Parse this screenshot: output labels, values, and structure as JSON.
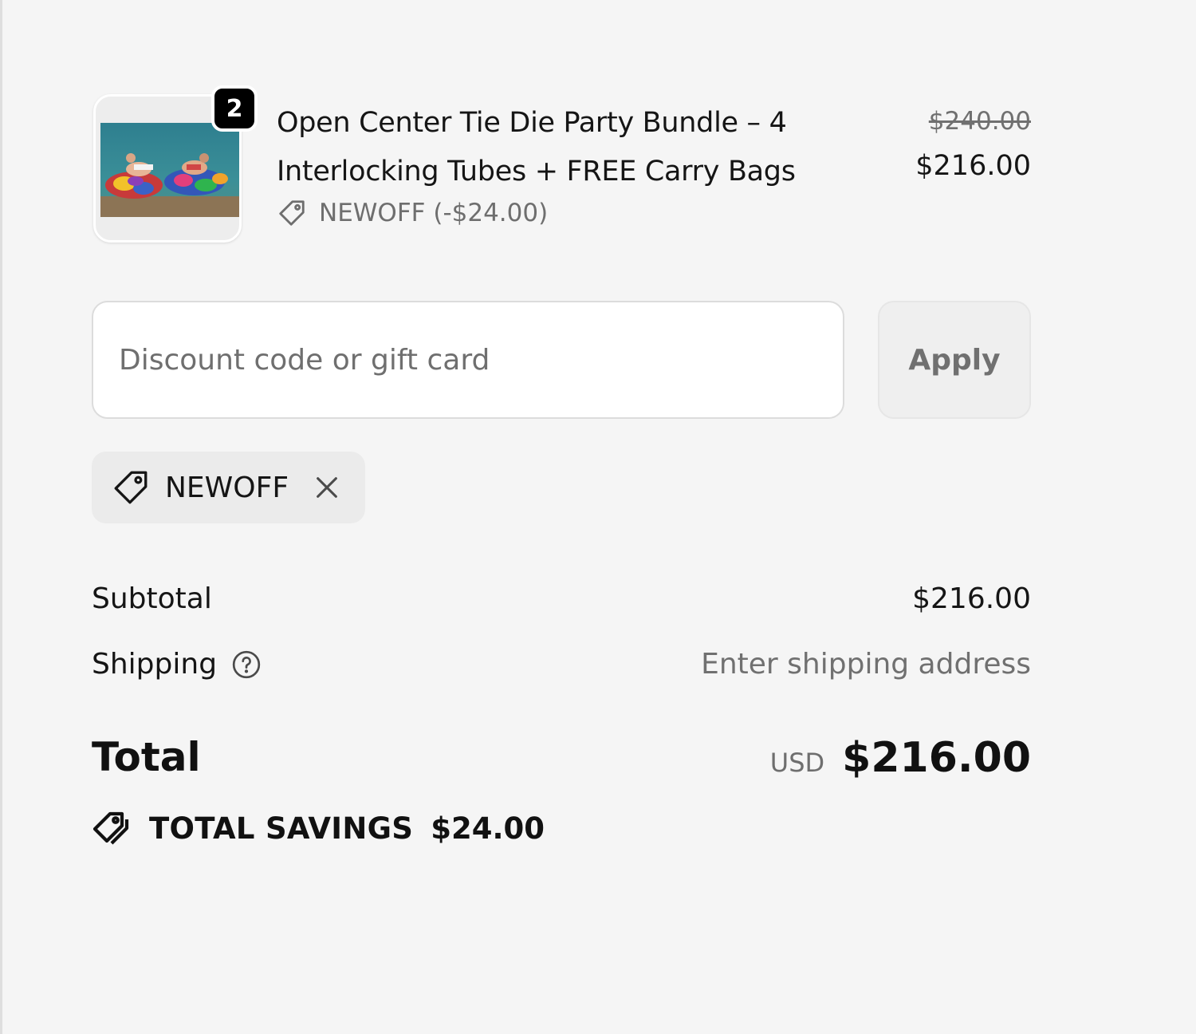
{
  "line_item": {
    "quantity": "2",
    "title": "Open Center Tie Die Party Bundle – 4 Interlocking Tubes + FREE Carry Bags",
    "discount_code_note": "NEWOFF (-$24.00)",
    "original_price": "$240.00",
    "price": "$216.00",
    "thumbnail_icon": "product-photo-inflatable-tubes"
  },
  "discount_form": {
    "placeholder": "Discount code or gift card",
    "value": "",
    "apply_label": "Apply"
  },
  "applied_code": {
    "label": "NEWOFF",
    "remove_icon": "close-icon"
  },
  "summary": {
    "subtotal_label": "Subtotal",
    "subtotal_value": "$216.00",
    "shipping_label": "Shipping",
    "shipping_value": "Enter shipping address",
    "total_label": "Total",
    "total_currency": "USD",
    "total_value": "$216.00",
    "savings_label": "TOTAL SAVINGS",
    "savings_value": "$24.00"
  },
  "colors": {
    "background": "#f5f5f5",
    "text": "#151515",
    "muted": "#707070",
    "badge": "#000000"
  }
}
